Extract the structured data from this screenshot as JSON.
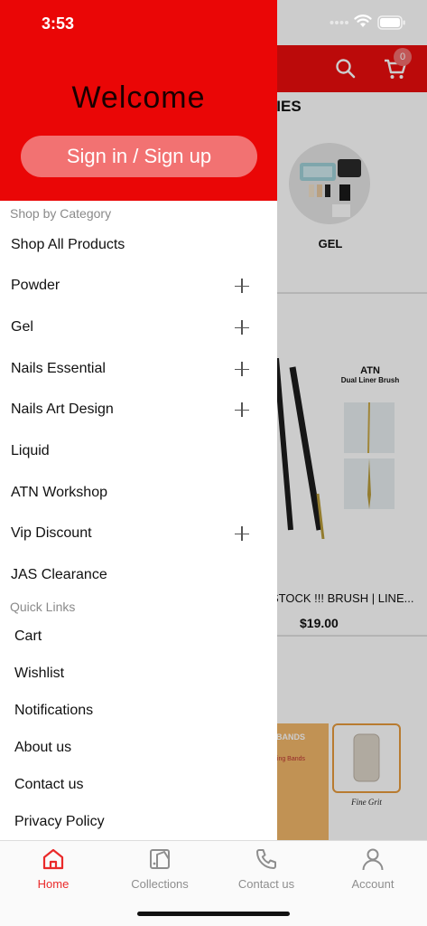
{
  "status_bar": {
    "time": "3:53"
  },
  "background": {
    "cart_count": "0",
    "section_title": "RIES",
    "category_label": "GEL",
    "product_title": "ATN",
    "product_subtitle": "Dual Liner Brush",
    "product_name": "STOCK !!! BRUSH | LINE...",
    "product_price": "$19.00",
    "bands_text": "BANDS",
    "bands_sub": "ding Bands",
    "grit_label": "Fine Grit"
  },
  "drawer": {
    "welcome": "Welcome",
    "signin_label": "Sign in / Sign up",
    "shop_by_category_label": "Shop by Category",
    "categories": [
      {
        "label": "Shop All Products",
        "expandable": false
      },
      {
        "label": "Powder",
        "expandable": true
      },
      {
        "label": "Gel",
        "expandable": true
      },
      {
        "label": "Nails Essential",
        "expandable": true
      },
      {
        "label": "Nails Art Design",
        "expandable": true
      },
      {
        "label": "Liquid",
        "expandable": false
      },
      {
        "label": "ATN Workshop",
        "expandable": false
      },
      {
        "label": "Vip Discount",
        "expandable": true
      },
      {
        "label": "JAS Clearance",
        "expandable": false
      }
    ],
    "quick_links_label": "Quick Links",
    "quick_links": [
      "Cart",
      "Wishlist",
      "Notifications",
      "About us",
      "Contact us",
      "Privacy Policy"
    ]
  },
  "bottom_nav": {
    "tabs": [
      {
        "label": "Home",
        "icon": "home-icon",
        "active": true
      },
      {
        "label": "Collections",
        "icon": "collections-icon",
        "active": false
      },
      {
        "label": "Contact us",
        "icon": "phone-icon",
        "active": false
      },
      {
        "label": "Account",
        "icon": "account-icon",
        "active": false
      }
    ]
  },
  "colors": {
    "brand_red": "#ea0606",
    "signin_button": "#f27272",
    "active_tab": "#ea2a2a",
    "inactive_tab": "#8e8e8e"
  }
}
